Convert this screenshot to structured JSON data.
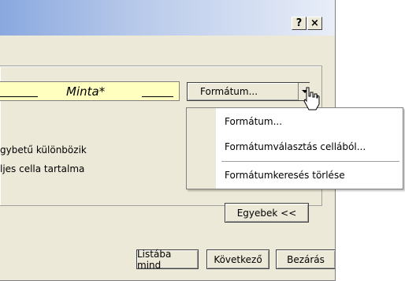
{
  "window": {
    "help_label": "?",
    "close_label": "×"
  },
  "preview": {
    "text": "Minta*"
  },
  "format_button": {
    "label": "Formátum..."
  },
  "options": {
    "case_label": "gybetű különbözik",
    "whole_cell_label": "ljes cella tartalma"
  },
  "format_menu": {
    "items": [
      "Formátum...",
      "Formátumválasztás cellából...",
      "Formátumkeresés törlése"
    ]
  },
  "buttons": {
    "options_label": "Egyebek <<",
    "find_all_label": "Listába mind",
    "find_next_label": "Következő",
    "close_label": "Bezárás"
  },
  "colors": {
    "dialog_bg": "#ece9d8",
    "preview_bg": "#ffffc0",
    "title_gradient_start": "#8aa8df"
  }
}
